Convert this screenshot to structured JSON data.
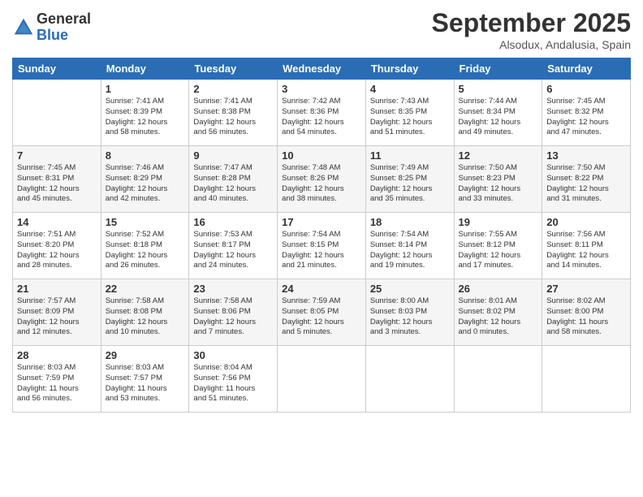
{
  "logo": {
    "general": "General",
    "blue": "Blue"
  },
  "header": {
    "month": "September 2025",
    "location": "Alsodux, Andalusia, Spain"
  },
  "weekdays": [
    "Sunday",
    "Monday",
    "Tuesday",
    "Wednesday",
    "Thursday",
    "Friday",
    "Saturday"
  ],
  "weeks": [
    [
      {
        "day": "",
        "info": ""
      },
      {
        "day": "1",
        "info": "Sunrise: 7:41 AM\nSunset: 8:39 PM\nDaylight: 12 hours\nand 58 minutes."
      },
      {
        "day": "2",
        "info": "Sunrise: 7:41 AM\nSunset: 8:38 PM\nDaylight: 12 hours\nand 56 minutes."
      },
      {
        "day": "3",
        "info": "Sunrise: 7:42 AM\nSunset: 8:36 PM\nDaylight: 12 hours\nand 54 minutes."
      },
      {
        "day": "4",
        "info": "Sunrise: 7:43 AM\nSunset: 8:35 PM\nDaylight: 12 hours\nand 51 minutes."
      },
      {
        "day": "5",
        "info": "Sunrise: 7:44 AM\nSunset: 8:34 PM\nDaylight: 12 hours\nand 49 minutes."
      },
      {
        "day": "6",
        "info": "Sunrise: 7:45 AM\nSunset: 8:32 PM\nDaylight: 12 hours\nand 47 minutes."
      }
    ],
    [
      {
        "day": "7",
        "info": "Sunrise: 7:45 AM\nSunset: 8:31 PM\nDaylight: 12 hours\nand 45 minutes."
      },
      {
        "day": "8",
        "info": "Sunrise: 7:46 AM\nSunset: 8:29 PM\nDaylight: 12 hours\nand 42 minutes."
      },
      {
        "day": "9",
        "info": "Sunrise: 7:47 AM\nSunset: 8:28 PM\nDaylight: 12 hours\nand 40 minutes."
      },
      {
        "day": "10",
        "info": "Sunrise: 7:48 AM\nSunset: 8:26 PM\nDaylight: 12 hours\nand 38 minutes."
      },
      {
        "day": "11",
        "info": "Sunrise: 7:49 AM\nSunset: 8:25 PM\nDaylight: 12 hours\nand 35 minutes."
      },
      {
        "day": "12",
        "info": "Sunrise: 7:50 AM\nSunset: 8:23 PM\nDaylight: 12 hours\nand 33 minutes."
      },
      {
        "day": "13",
        "info": "Sunrise: 7:50 AM\nSunset: 8:22 PM\nDaylight: 12 hours\nand 31 minutes."
      }
    ],
    [
      {
        "day": "14",
        "info": "Sunrise: 7:51 AM\nSunset: 8:20 PM\nDaylight: 12 hours\nand 28 minutes."
      },
      {
        "day": "15",
        "info": "Sunrise: 7:52 AM\nSunset: 8:18 PM\nDaylight: 12 hours\nand 26 minutes."
      },
      {
        "day": "16",
        "info": "Sunrise: 7:53 AM\nSunset: 8:17 PM\nDaylight: 12 hours\nand 24 minutes."
      },
      {
        "day": "17",
        "info": "Sunrise: 7:54 AM\nSunset: 8:15 PM\nDaylight: 12 hours\nand 21 minutes."
      },
      {
        "day": "18",
        "info": "Sunrise: 7:54 AM\nSunset: 8:14 PM\nDaylight: 12 hours\nand 19 minutes."
      },
      {
        "day": "19",
        "info": "Sunrise: 7:55 AM\nSunset: 8:12 PM\nDaylight: 12 hours\nand 17 minutes."
      },
      {
        "day": "20",
        "info": "Sunrise: 7:56 AM\nSunset: 8:11 PM\nDaylight: 12 hours\nand 14 minutes."
      }
    ],
    [
      {
        "day": "21",
        "info": "Sunrise: 7:57 AM\nSunset: 8:09 PM\nDaylight: 12 hours\nand 12 minutes."
      },
      {
        "day": "22",
        "info": "Sunrise: 7:58 AM\nSunset: 8:08 PM\nDaylight: 12 hours\nand 10 minutes."
      },
      {
        "day": "23",
        "info": "Sunrise: 7:58 AM\nSunset: 8:06 PM\nDaylight: 12 hours\nand 7 minutes."
      },
      {
        "day": "24",
        "info": "Sunrise: 7:59 AM\nSunset: 8:05 PM\nDaylight: 12 hours\nand 5 minutes."
      },
      {
        "day": "25",
        "info": "Sunrise: 8:00 AM\nSunset: 8:03 PM\nDaylight: 12 hours\nand 3 minutes."
      },
      {
        "day": "26",
        "info": "Sunrise: 8:01 AM\nSunset: 8:02 PM\nDaylight: 12 hours\nand 0 minutes."
      },
      {
        "day": "27",
        "info": "Sunrise: 8:02 AM\nSunset: 8:00 PM\nDaylight: 11 hours\nand 58 minutes."
      }
    ],
    [
      {
        "day": "28",
        "info": "Sunrise: 8:03 AM\nSunset: 7:59 PM\nDaylight: 11 hours\nand 56 minutes."
      },
      {
        "day": "29",
        "info": "Sunrise: 8:03 AM\nSunset: 7:57 PM\nDaylight: 11 hours\nand 53 minutes."
      },
      {
        "day": "30",
        "info": "Sunrise: 8:04 AM\nSunset: 7:56 PM\nDaylight: 11 hours\nand 51 minutes."
      },
      {
        "day": "",
        "info": ""
      },
      {
        "day": "",
        "info": ""
      },
      {
        "day": "",
        "info": ""
      },
      {
        "day": "",
        "info": ""
      }
    ]
  ]
}
